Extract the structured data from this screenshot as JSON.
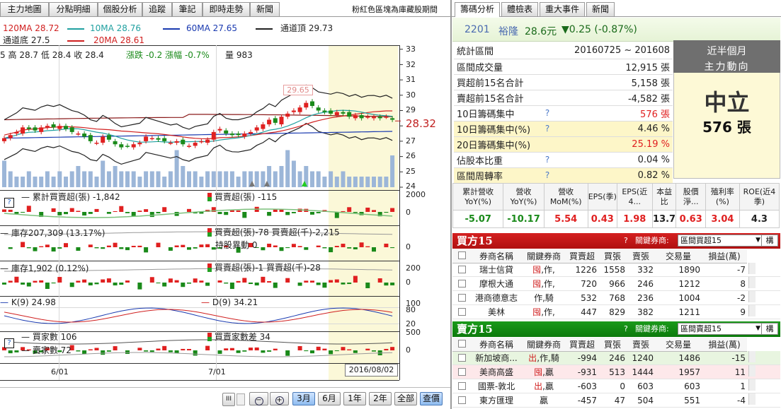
{
  "top_tabs": [
    "主力地圖",
    "分點明細",
    "個股分析",
    "追蹤",
    "筆記",
    "即時走勢",
    "新聞"
  ],
  "header_note": "粉紅色區塊為庫藏股期間",
  "right_tabs": [
    "籌碼分析",
    "體檢表",
    "重大事件",
    "新聞"
  ],
  "ma_legend": {
    "row1": [
      {
        "label": "120MA 28.72",
        "color": "#d02020"
      },
      {
        "label": "10MA 28.76",
        "color": "#20a0a0"
      },
      {
        "label": "60MA 27.65",
        "color": "#1a3ab0"
      },
      {
        "label": "通道頂 29.73",
        "color": "#222222"
      }
    ],
    "row2": [
      {
        "label": "通道底 27.5",
        "color": "#222222"
      },
      {
        "label": "20MA 28.61",
        "color": "#d02020"
      }
    ]
  },
  "ohlc": {
    "open": "5",
    "high_label": "高",
    "high": "28.7",
    "low_label": "低",
    "low": "28.4",
    "close_label": "收",
    "close": "28.4",
    "chg_label": "漲跌",
    "chg": "-0.2",
    "pct_label": "漲幅",
    "pct": "-0.7%",
    "vol_label": "量",
    "vol": "983"
  },
  "price_axis": [
    "33",
    "32",
    "31",
    "30",
    "29",
    "28",
    "27",
    "26",
    "25",
    "24"
  ],
  "price_current": "28.32",
  "price_peak": "29.65",
  "sub1": {
    "a": "累計買賣超(張) -1,842",
    "b": "買賣超(張) -115",
    "axis": [
      "2000",
      "0"
    ]
  },
  "sub2": {
    "a": "庫存207,309 (13.17%)",
    "b": "買賣超(張)-78 買賣超(千)-2,215",
    "c": "持股異動 0",
    "axis": [
      "0"
    ]
  },
  "sub3": {
    "a": "庫存1,902 (0.12%)",
    "b": "買賣超(張)-1 買賣超(千)-28",
    "axis": [
      "200",
      "0"
    ]
  },
  "sub4": {
    "a": "K(9) 24.98",
    "b": "D(9) 34.21",
    "axis": [
      "100",
      "80",
      "20",
      "0"
    ]
  },
  "sub5": {
    "a": "買家數 106",
    "b": "買賣家數差 34",
    "c": "賣家數 72",
    "axis": [
      "500",
      "0"
    ]
  },
  "x_labels": [
    "6/01",
    "7/01"
  ],
  "cursor_date": "2016/08/02",
  "bottom_buttons": {
    "scroll": "III",
    "zoom_out": "−",
    "zoom_in": "+",
    "periods": [
      "3月",
      "6月",
      "1年",
      "2年",
      "全部"
    ],
    "active": "3月",
    "query": "查價"
  },
  "stock": {
    "code": "2201",
    "name": "裕隆",
    "price": "28.6元",
    "change": "▼0.25 (-0.87%)"
  },
  "stats": [
    {
      "k": "統計區間",
      "v": "20160725 ~ 201608",
      "q": false,
      "color": "#222222",
      "hl": false
    },
    {
      "k": "區間成交量",
      "v": "12,915 張",
      "q": false,
      "color": "#222222",
      "hl": false
    },
    {
      "k": "買超前15名合計",
      "v": "5,158 張",
      "q": false,
      "color": "#222222",
      "hl": false
    },
    {
      "k": "賣超前15名合計",
      "v": "-4,582 張",
      "q": false,
      "color": "#222222",
      "hl": false
    },
    {
      "k": "10日籌碼集中",
      "v": "576 張",
      "q": true,
      "color": "#e02020",
      "hl": false
    },
    {
      "k": "10日籌碼集中(%)",
      "v": "4.46 %",
      "q": true,
      "color": "#222222",
      "hl": true
    },
    {
      "k": "20日籌碼集中(%)",
      "v": "25.19 %",
      "q": false,
      "color": "#e02020",
      "hl": true
    },
    {
      "k": "佔股本比重",
      "v": "0.04 %",
      "q": true,
      "color": "#222222",
      "hl": false
    },
    {
      "k": "區間周轉率",
      "v": "0.82 %",
      "q": true,
      "color": "#222222",
      "hl": true
    }
  ],
  "trend": {
    "title1": "近半個月",
    "title2": "主力動向",
    "state": "中立",
    "amount": "576 張"
  },
  "fund_headers": [
    "累計營收YoY(%)",
    "營收YoY(%)",
    "營收MoM(%)",
    "EPS(季)",
    "EPS(近4...",
    "本益比",
    "股價淨...",
    "殖利率(%)",
    "ROE(近4季)"
  ],
  "fund_values": [
    {
      "v": "-5.07",
      "c": "#1a8a1a"
    },
    {
      "v": "-10.17",
      "c": "#1a8a1a"
    },
    {
      "v": "5.54",
      "c": "#e02020"
    },
    {
      "v": "0.43",
      "c": "#e02020"
    },
    {
      "v": "1.98",
      "c": "#e02020"
    },
    {
      "v": "13.7",
      "c": "#222222"
    },
    {
      "v": "0.63",
      "c": "#e02020"
    },
    {
      "v": "3.04",
      "c": "#e02020"
    },
    {
      "v": "4.3",
      "c": "#222222"
    }
  ],
  "buy": {
    "title": "買方15",
    "q": "?",
    "key_label": "關鍵券商:",
    "select": "區間買超15",
    "more": "構",
    "headers": [
      "券商名稱",
      "關鍵券商",
      "買賣超",
      "買張",
      "賣張",
      "交易量",
      "損益(萬)"
    ],
    "rows": [
      {
        "name": "瑞士信貸",
        "tag1": "囤",
        "tag2": ",作,",
        "c1": "1226",
        "c2": "1558",
        "c3": "332",
        "c4": "1890",
        "c5": "-7",
        "bg": "#ffffff"
      },
      {
        "name": "摩根大通",
        "tag1": "囤",
        "tag2": ",作,",
        "c1": "720",
        "c2": "966",
        "c3": "246",
        "c4": "1212",
        "c5": "8",
        "bg": "#ffffff"
      },
      {
        "name": "港商德意志",
        "tag1": "",
        "tag2": "作,騎",
        "c1": "532",
        "c2": "768",
        "c3": "236",
        "c4": "1004",
        "c5": "-2",
        "bg": "#ffffff"
      },
      {
        "name": "美林",
        "tag1": "囤",
        "tag2": ",作,",
        "c1": "447",
        "c2": "829",
        "c3": "382",
        "c4": "1211",
        "c5": "9",
        "bg": "#ffffff"
      }
    ]
  },
  "sell": {
    "title": "賣方15",
    "q": "?",
    "key_label": "關鍵券商:",
    "select": "區間賣超15",
    "more": "構",
    "headers": [
      "券商名稱",
      "關鍵券商",
      "買賣超",
      "買張",
      "賣張",
      "交易量",
      "損益(萬)"
    ],
    "rows": [
      {
        "name": "新加坡商...",
        "tag1": "出",
        "tag2": ",作,騎",
        "c1": "-994",
        "c2": "246",
        "c3": "1240",
        "c4": "1486",
        "c5": "-15",
        "bg": "#e8f5e0"
      },
      {
        "name": "美商高盛",
        "tag1": "囤",
        "tag2": ",贏",
        "c1": "-931",
        "c2": "513",
        "c3": "1444",
        "c4": "1957",
        "c5": "11",
        "bg": "#fde8ea"
      },
      {
        "name": "國票-敦北",
        "tag1": "出",
        "tag2": ",贏",
        "c1": "-603",
        "c2": "0",
        "c3": "603",
        "c4": "603",
        "c5": "1",
        "bg": "#ffffff"
      },
      {
        "name": "東方匯理",
        "tag1": "",
        "tag2": "贏",
        "c1": "-457",
        "c2": "47",
        "c3": "504",
        "c4": "551",
        "c5": "-4",
        "bg": "#ffffff"
      }
    ]
  }
}
